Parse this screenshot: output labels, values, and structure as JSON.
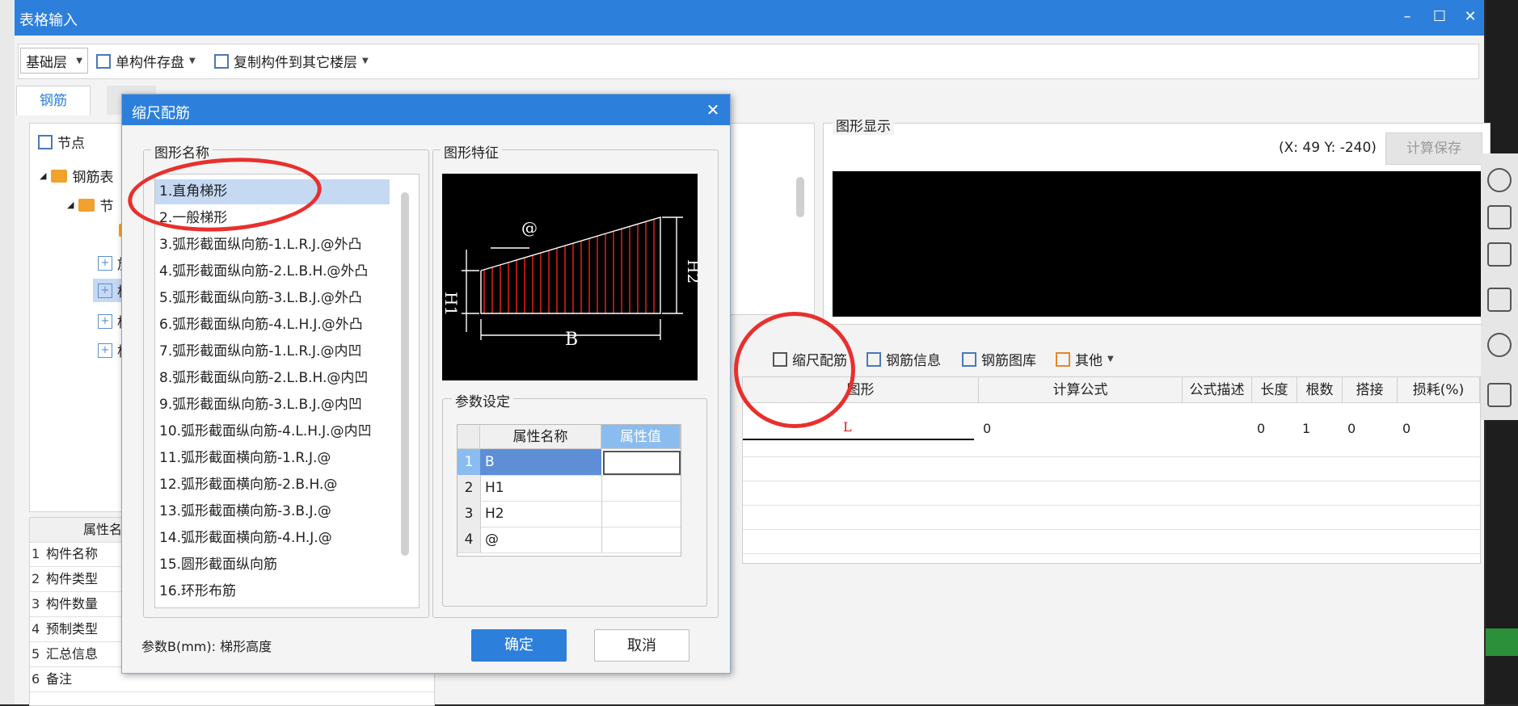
{
  "main_window": {
    "title": "表格输入"
  },
  "toolbar": {
    "floor": "基础层",
    "save_component": "单构件存盘",
    "copy_component": "复制构件到其它楼层"
  },
  "tabs": [
    {
      "label": "钢筋"
    }
  ],
  "left_panel": {
    "node_button": "节点",
    "tree": [
      {
        "label": "钢筋表"
      },
      {
        "label": "节"
      },
      {
        "label": "放"
      },
      {
        "label": "构"
      },
      {
        "label": "构"
      },
      {
        "label": "构"
      }
    ],
    "prop_header": "属性名称",
    "props": [
      {
        "num": "1",
        "name": "构件名称"
      },
      {
        "num": "2",
        "name": "构件类型"
      },
      {
        "num": "3",
        "name": "构件数量"
      },
      {
        "num": "4",
        "name": "预制类型"
      },
      {
        "num": "5",
        "name": "汇总信息"
      },
      {
        "num": "6",
        "name": "备注"
      }
    ]
  },
  "graphic_display": {
    "legend": "图形显示",
    "coords": "(X: 49 Y: -240)",
    "save_button": "计算保存"
  },
  "lower_toolbar": {
    "scale_rebar": "缩尺配筋",
    "rebar_info": "钢筋信息",
    "rebar_library": "钢筋图库",
    "other": "其他"
  },
  "grid": {
    "headers": [
      "图形",
      "计算公式",
      "公式描述",
      "长度",
      "根数",
      "搭接",
      "损耗(%)"
    ],
    "row": {
      "shape": "L",
      "formula": "0",
      "length": "0",
      "count": "1",
      "lap": "0",
      "loss": "0"
    }
  },
  "dialog": {
    "title": "缩尺配筋",
    "shape_name_legend": "图形名称",
    "shape_feature_legend": "图形特征",
    "param_legend": "参数设定",
    "shapes": [
      "1.直角梯形",
      "2.一般梯形",
      "3.弧形截面纵向筋-1.L.R.J.@外凸",
      "4.弧形截面纵向筋-2.L.B.H.@外凸",
      "5.弧形截面纵向筋-3.L.B.J.@外凸",
      "6.弧形截面纵向筋-4.L.H.J.@外凸",
      "7.弧形截面纵向筋-1.L.R.J.@内凹",
      "8.弧形截面纵向筋-2.L.B.H.@内凹",
      "9.弧形截面纵向筋-3.L.B.J.@内凹",
      "10.弧形截面纵向筋-4.L.H.J.@内凹",
      "11.弧形截面横向筋-1.R.J.@",
      "12.弧形截面横向筋-2.B.H.@",
      "13.弧形截面横向筋-3.B.J.@",
      "14.弧形截面横向筋-4.H.J.@",
      "15.圆形截面纵向筋",
      "16.环形布筋"
    ],
    "preview_labels": {
      "at": "@",
      "h1": "H1",
      "h2": "H2",
      "b": "B"
    },
    "param_headers": {
      "name": "属性名称",
      "value": "属性值"
    },
    "params": [
      {
        "num": "1",
        "name": "B"
      },
      {
        "num": "2",
        "name": "H1"
      },
      {
        "num": "3",
        "name": "H2"
      },
      {
        "num": "4",
        "name": "@"
      }
    ],
    "hint": "参数B(mm): 梯形高度",
    "ok": "确定",
    "cancel": "取消"
  },
  "colors": {
    "accent": "#2d7fdc",
    "annotation": "#e8302d",
    "rebar": "#d81b1b"
  }
}
